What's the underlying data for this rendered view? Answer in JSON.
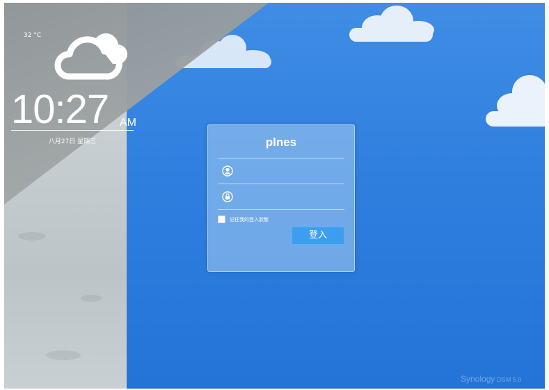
{
  "weather": {
    "temperature": "32 °C",
    "icon": "cloud-icon"
  },
  "clock": {
    "time": "10:27",
    "ampm": "AM",
    "date": "八月27日 星期三"
  },
  "login": {
    "server_name": "plnes",
    "username": {
      "value": "",
      "placeholder": "",
      "icon": "user-icon"
    },
    "password": {
      "value": "",
      "placeholder": "",
      "icon": "lock-icon"
    },
    "remember_label": "記住我的登入狀態",
    "remember_checked": false,
    "submit_label": "登入"
  },
  "brand": {
    "name": "Synology",
    "version": "DSM 5.0"
  },
  "colors": {
    "sky": "#2f7fdf",
    "button": "#3d9ef0"
  }
}
